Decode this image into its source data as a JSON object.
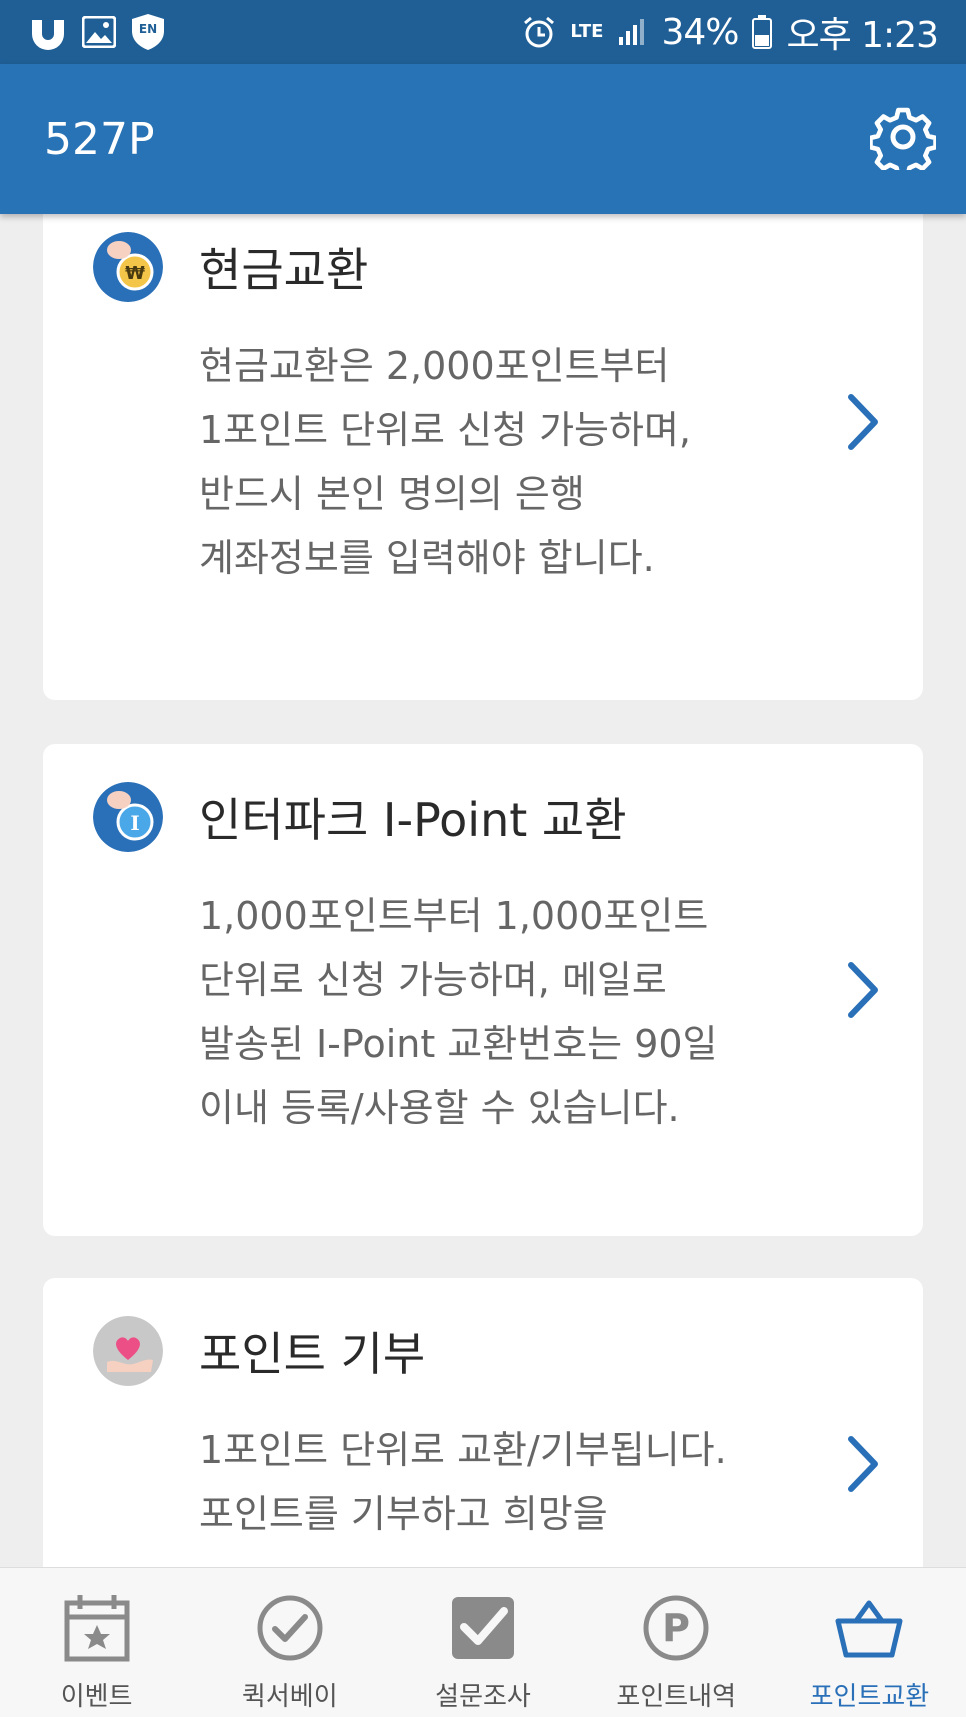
{
  "status_bar": {
    "icons_left": [
      "u-plus-icon",
      "gallery-icon",
      "en-shield-icon"
    ],
    "network": "LTE",
    "battery": "34%",
    "time": "오후 1:23"
  },
  "app_bar": {
    "points": "527P",
    "settings_icon": "gear-icon"
  },
  "cards": [
    {
      "icon": "won-coin-icon",
      "title": "현금교환",
      "description": [
        "현금교환은 2,000포인트부터",
        "1포인트 단위로 신청 가능하며,",
        "반드시 본인 명의의 은행",
        "계좌정보를 입력해야 합니다."
      ]
    },
    {
      "icon": "i-point-coin-icon",
      "title": "인터파크 I-Point 교환",
      "description": [
        "1,000포인트부터 1,000포인트",
        "단위로 신청 가능하며, 메일로",
        "발송된 I-Point 교환번호는 90일",
        "이내 등록/사용할 수 있습니다."
      ]
    },
    {
      "icon": "heart-hand-icon",
      "title": "포인트 기부",
      "description": [
        "1포인트 단위로 교환/기부됩니다.",
        "포인트를 기부하고 희망을"
      ]
    }
  ],
  "bottom_nav": [
    {
      "label": "이벤트",
      "icon": "calendar-star-icon",
      "active": false
    },
    {
      "label": "퀵서베이",
      "icon": "check-circle-icon",
      "active": false
    },
    {
      "label": "설문조사",
      "icon": "checkbox-icon",
      "active": false
    },
    {
      "label": "포인트내역",
      "icon": "p-circle-icon",
      "active": false
    },
    {
      "label": "포인트교환",
      "icon": "basket-icon",
      "active": true
    }
  ],
  "colors": {
    "status_bar": "#1f5f96",
    "app_bar": "#2873b5",
    "accent": "#2a70b8",
    "background": "#eeeeee"
  }
}
